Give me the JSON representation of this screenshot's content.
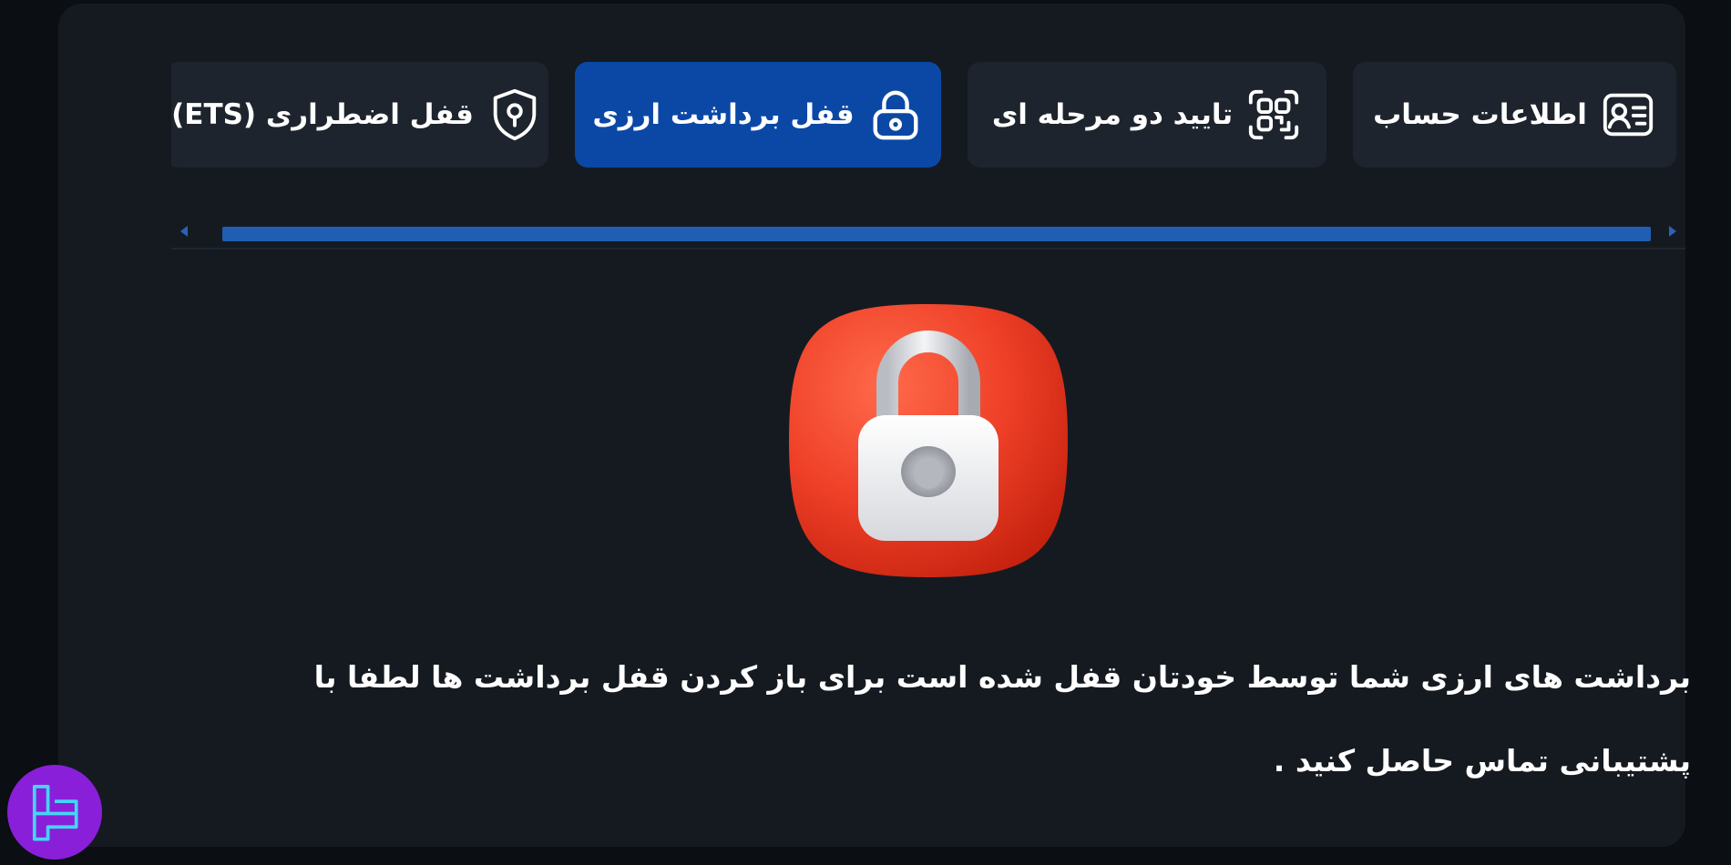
{
  "tabs": [
    {
      "label": "اطلاعات حساب",
      "icon": "id-card-icon",
      "active": false
    },
    {
      "label": "تایید دو مرحله ای",
      "icon": "qr-scan-icon",
      "active": false
    },
    {
      "label": "قفل برداشت ارزی",
      "icon": "lock-icon",
      "active": true
    },
    {
      "label": "قفل اضطراری (ETS)",
      "icon": "shield-icon",
      "active": false
    }
  ],
  "lock_panel": {
    "illustration": "padlock-illustration",
    "message": "برداشت های ارزی شما توسط خودتان قفل شده است برای باز کردن قفل برداشت ها لطفا با پشتیبانی تماس حاصل کنید ."
  },
  "colors": {
    "active_tab": "#0b48a6",
    "tab_bg": "#1e242d",
    "panel_bg": "#151a21",
    "page_bg": "#0b0e13",
    "scrollbar": "#1f5eb3",
    "lock_red": "#e8402a",
    "logo_purple": "#8a1fd9"
  },
  "branding": {
    "logo": "tradingfinder-logo-icon"
  }
}
